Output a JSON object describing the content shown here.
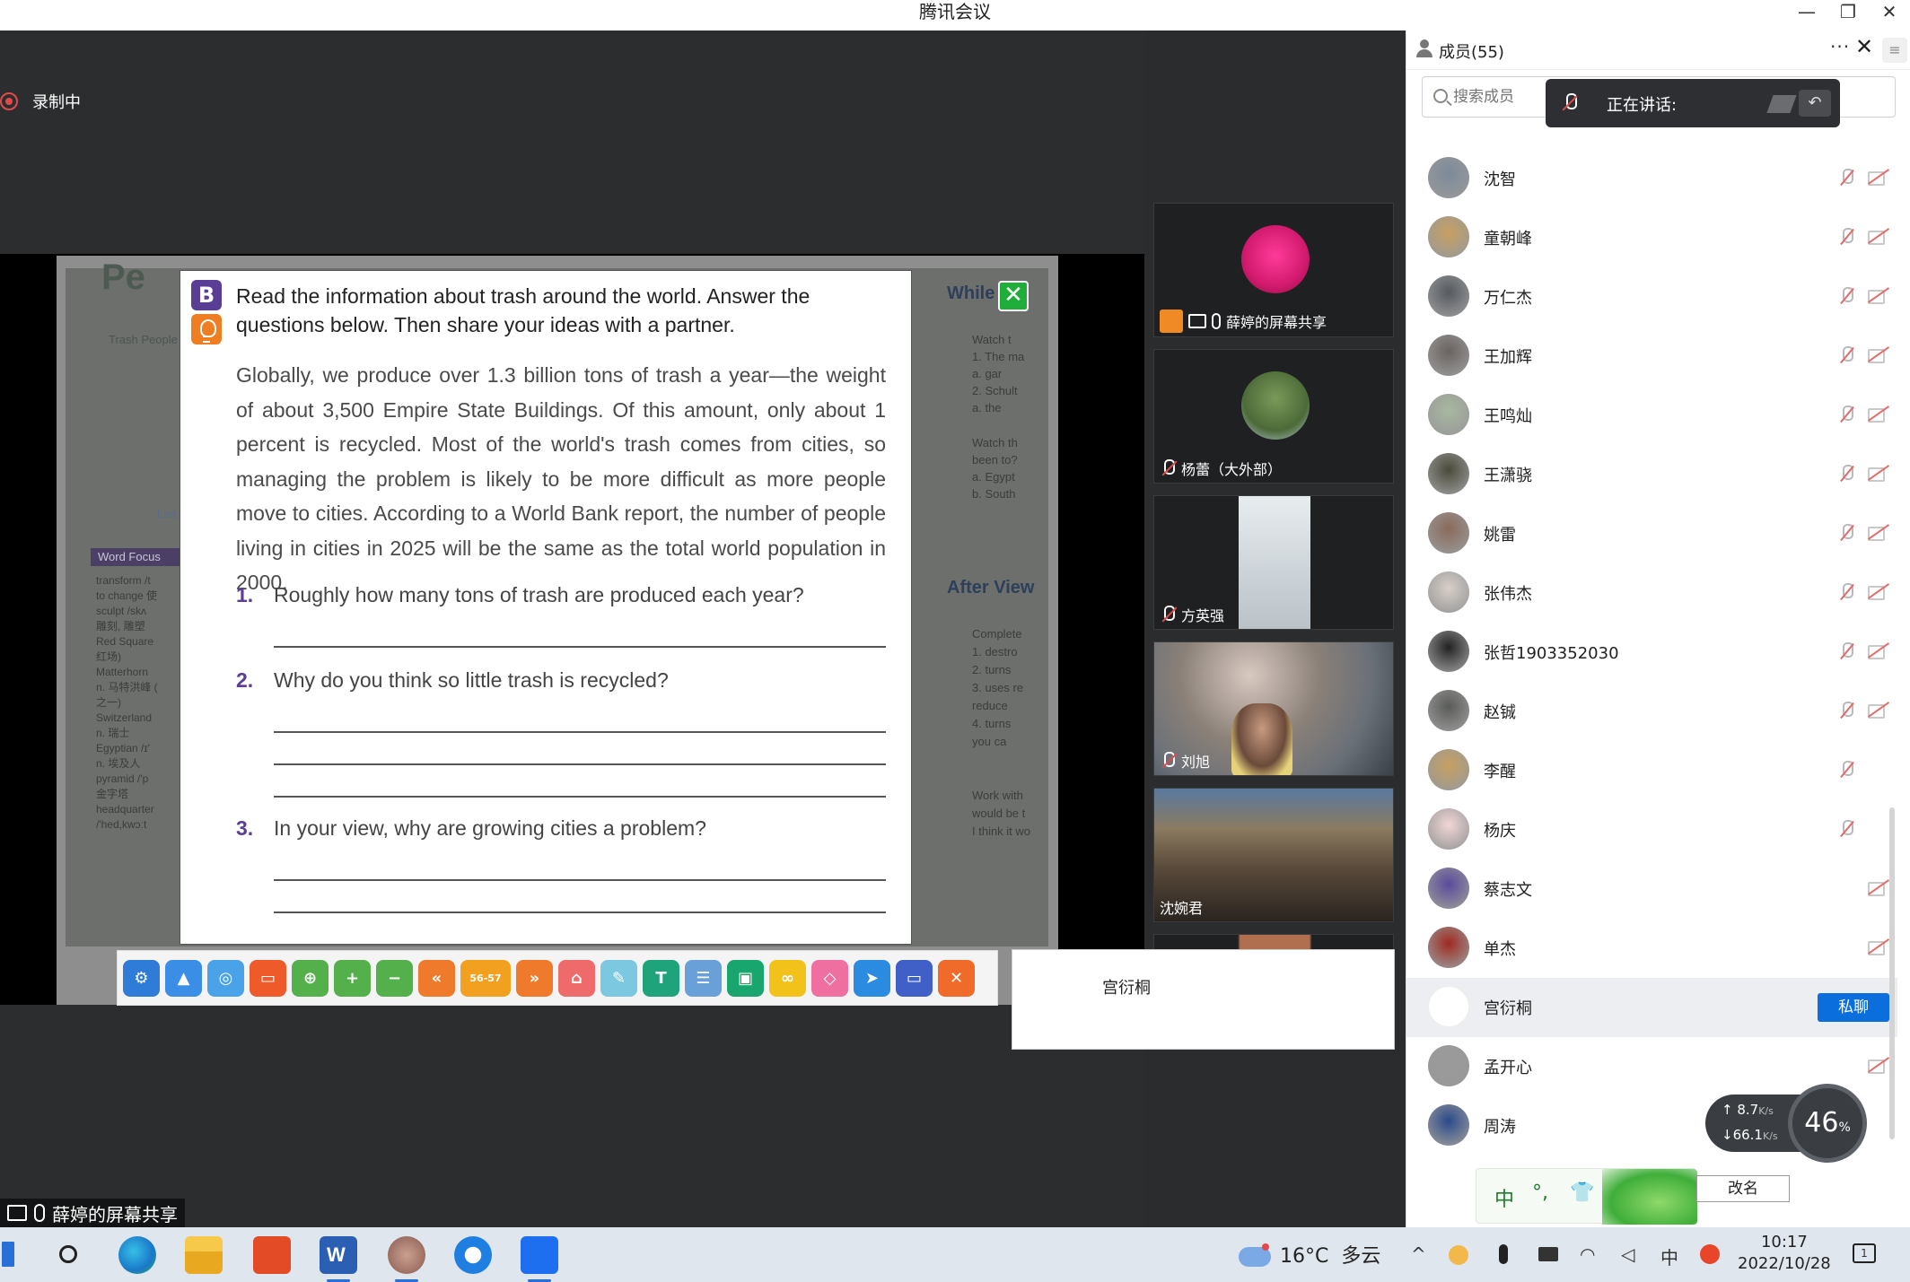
{
  "window": {
    "title": "腾讯会议",
    "minimize": "—",
    "restore": "❐",
    "close": "✕"
  },
  "stage": {
    "recording_label": "录制中",
    "share_label": "薛婷的屏幕共享"
  },
  "document": {
    "background_texts": {
      "top_word": "Pe",
      "tab": "Trash People",
      "learn": "Lea",
      "word_focus": "Word Focus",
      "left_terms": [
        "transform /t",
        "to change 使",
        "sculpt /skʌ",
        "雕刻, 雕塑",
        "Red Square",
        "红场)",
        "Matterhorn",
        "n. 马特洪峰 (",
        "之一)",
        "Switzerland",
        "n. 瑞士",
        "Egyptian /ɪ'",
        "n. 埃及人",
        "pyramid /'p",
        "金字塔",
        "headquarter",
        "/'hed,kwɔːt"
      ],
      "right_heading": "While",
      "right_lines": [
        "Watch t",
        "1. The ma",
        "a. gar",
        "2. Schult",
        "a. the",
        "Watch th",
        "been to?",
        "a. Egypt",
        "b. South"
      ],
      "after_view": "After View",
      "right_lines2": [
        "Complete",
        "1. destro",
        "2. turns",
        "3. uses re",
        "reduce",
        "4. turns",
        "you ca",
        "Work with",
        "would be t",
        "I think it wo"
      ]
    },
    "card": {
      "badge": "B",
      "instruction": "Read the information about trash around the world. Answer the questions below. Then share your ideas with a partner.",
      "paragraph": "Globally, we produce over 1.3 billion tons of trash a year—the weight of about 3,500 Empire State Buildings. Of this amount, only about 1 percent is recycled. Most of the world's trash comes from cities, so managing the problem is likely to be more difficult as more people move to cities. According to a World Bank report, the number of people living in cities in 2025 will be the same as the total world population in 2000.",
      "questions": [
        {
          "num": "1.",
          "text": "Roughly how many tons of trash are produced each year?"
        },
        {
          "num": "2.",
          "text": "Why do you think so little trash is recycled?"
        },
        {
          "num": "3.",
          "text": "In your view, why are growing cities a problem?"
        }
      ]
    },
    "close_icon": "✕",
    "toolbar_icons": [
      {
        "name": "tools-icon",
        "color": "#2f7bd8",
        "glyph": "⚙"
      },
      {
        "name": "photo-icon",
        "color": "#3b8ee6",
        "glyph": "▲"
      },
      {
        "name": "camera-icon",
        "color": "#4aa3e8",
        "glyph": "◎"
      },
      {
        "name": "open-folder-icon",
        "color": "#ee5a2a",
        "glyph": "▭"
      },
      {
        "name": "zoom-fit-icon",
        "color": "#53b04a",
        "glyph": "⊕"
      },
      {
        "name": "zoom-in-icon",
        "color": "#53b04a",
        "glyph": "+"
      },
      {
        "name": "zoom-out-icon",
        "color": "#53b04a",
        "glyph": "−"
      },
      {
        "name": "prev-page-icon",
        "color": "#f07a2c",
        "glyph": "«"
      },
      {
        "name": "page-indicator-icon",
        "color": "#f2a020",
        "glyph": "56-57",
        "wide": true
      },
      {
        "name": "next-page-icon",
        "color": "#f07a2c",
        "glyph": "»"
      },
      {
        "name": "home-icon",
        "color": "#ef6b6b",
        "glyph": "⌂"
      },
      {
        "name": "pen-icon",
        "color": "#7bc8e0",
        "glyph": "✎"
      },
      {
        "name": "text-icon",
        "color": "#1fa37a",
        "glyph": "T"
      },
      {
        "name": "notepad-icon",
        "color": "#6aa0d8",
        "glyph": "☰"
      },
      {
        "name": "screen-icon",
        "color": "#19a56e",
        "glyph": "▣"
      },
      {
        "name": "link-icon",
        "color": "#f2c21b",
        "glyph": "∞"
      },
      {
        "name": "eraser-icon",
        "color": "#ee6fa0",
        "glyph": "◇"
      },
      {
        "name": "pointer-icon",
        "color": "#2a8be0",
        "glyph": "➤"
      },
      {
        "name": "window-icon",
        "color": "#4060c8",
        "glyph": "▭"
      },
      {
        "name": "exit-icon",
        "color": "#f06a2a",
        "glyph": "✕"
      }
    ]
  },
  "tiles": [
    {
      "label": "薛婷的屏幕共享",
      "type": "share"
    },
    {
      "label": "杨蕾（大外部）",
      "type": "avatar-tree"
    },
    {
      "label": "方英强",
      "type": "slim"
    },
    {
      "label": "刘旭",
      "type": "video"
    },
    {
      "label": "沈婉君",
      "type": "room"
    }
  ],
  "hover_card": {
    "name": "宫衍桐"
  },
  "panel": {
    "title": "成员(55)",
    "more": "···",
    "close": "✕",
    "menu": "≡",
    "search_placeholder": "搜索成员",
    "speaking_label": "正在讲话:",
    "speaking_ctl": "↶",
    "members": [
      {
        "name": "沈智",
        "mic": true,
        "cam": true,
        "av": "#7c8a9a"
      },
      {
        "name": "童朝峰",
        "mic": true,
        "cam": true,
        "av": "#c8a060"
      },
      {
        "name": "万仁杰",
        "mic": true,
        "cam": true,
        "av": "#555a60"
      },
      {
        "name": "王加辉",
        "mic": true,
        "cam": true,
        "av": "#6a6360"
      },
      {
        "name": "王鸣灿",
        "mic": true,
        "cam": true,
        "av": "#a8b8a0"
      },
      {
        "name": "王潇骁",
        "mic": true,
        "cam": true,
        "av": "#4a4a3a"
      },
      {
        "name": "姚雷",
        "mic": true,
        "cam": true,
        "av": "#8a6a5a"
      },
      {
        "name": "张伟杰",
        "mic": true,
        "cam": true,
        "av": "#d8cfc8"
      },
      {
        "name": "张哲1903352030",
        "mic": true,
        "cam": true,
        "av": "#222222"
      },
      {
        "name": "赵铖",
        "mic": true,
        "cam": true,
        "av": "#5a5c58"
      },
      {
        "name": "李醒",
        "mic": true,
        "cam": false,
        "av": "#c8a060"
      },
      {
        "name": "杨庆",
        "mic": true,
        "cam": false,
        "av": "#f2d6d6"
      },
      {
        "name": "蔡志文",
        "mic": false,
        "cam": true,
        "av": "#5a4a9a"
      },
      {
        "name": "单杰",
        "mic": false,
        "cam": true,
        "av": "#a02a20"
      },
      {
        "name": "宫衍桐",
        "mic": false,
        "cam": false,
        "av": "#ffffff",
        "highlight": true,
        "button": "私聊"
      },
      {
        "name": "孟开心",
        "mic": false,
        "cam": true,
        "av": "#9a9a9a"
      },
      {
        "name": "周涛",
        "mic": false,
        "cam": false,
        "av": "#2a4a8a"
      }
    ],
    "network": {
      "up": "8.7",
      "down": "66.1",
      "unit": "K/s",
      "cpu": "46",
      "cpu_unit": "%"
    },
    "ime": {
      "lang": "中",
      "punct": "°,",
      "skin": "👕"
    },
    "rename": "改名"
  },
  "taskbar": {
    "weather_temp": "16°C",
    "weather_desc": "多云",
    "time": "10:17",
    "date": "2022/10/28",
    "tray_up": "^",
    "ime_lang": "中",
    "notification_count": "1"
  }
}
